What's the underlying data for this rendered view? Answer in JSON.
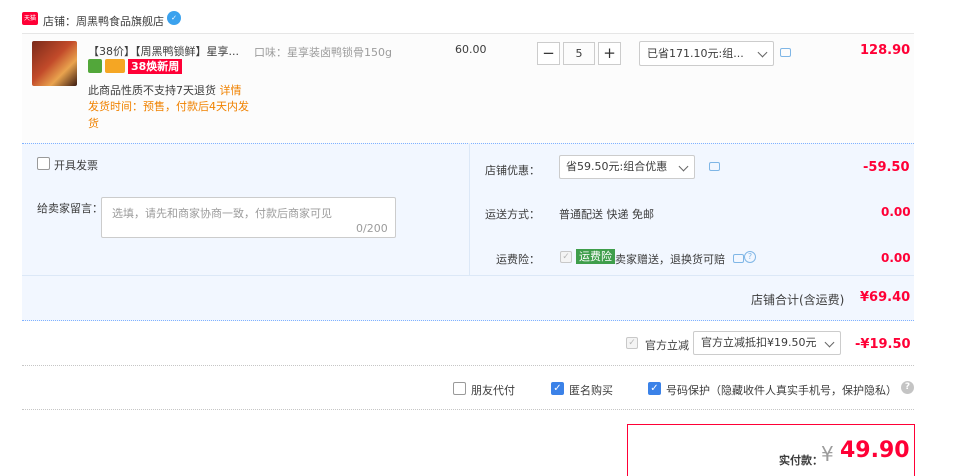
{
  "shop": {
    "icon_name": "tmall-shop-icon",
    "label": "店铺：周黑鸭食品旗舰店",
    "contact_icon_name": "wangwang-chat-icon"
  },
  "item": {
    "title": "【38价】【周黑鸭锁鲜】星享...",
    "promo_badge": "38焕新周",
    "notice": "此商品性质不支持7天退货",
    "notice_link": "详情",
    "ship_time": "发货时间：预售，付款后4天内发货",
    "spec": "口味：星享装卤鸭锁骨150g",
    "unit_price": "60.00",
    "quantity": "5",
    "qty_minus": "−",
    "qty_plus": "+",
    "discount_selected": "已省171.10元:组...",
    "subtotal": "128.90"
  },
  "options": {
    "invoice_label": "开具发票",
    "message_label": "给卖家留言：",
    "message_placeholder": "选填，请先和商家协商一致，付款后商家可见",
    "message_count": "0/200",
    "shop_discount_label": "店铺优惠：",
    "shop_discount_selected": "省59.50元:组合优惠",
    "shop_discount_amount": "-59.50",
    "shipping_label": "运送方式：",
    "shipping_value": "普通配送 快递 免邮",
    "shipping_amount": "0.00",
    "insurance_label": "运费险：",
    "insurance_tag": "运费险",
    "insurance_text": "卖家赠送，退换货可赔",
    "insurance_amount": "0.00",
    "shop_total_label": "店铺合计(含运费)",
    "shop_total_amount": "¥69.40"
  },
  "official": {
    "label": "官方立减",
    "selected": "官方立减抵扣¥19.50元",
    "amount": "-¥19.50"
  },
  "privacy": {
    "friend_pay_label": "朋友代付",
    "friend_pay_checked": false,
    "anonymous_label": "匿名购买",
    "anonymous_checked": true,
    "phone_protect_label": "号码保护（隐藏收件人真实手机号，保护隐私）",
    "phone_protect_checked": true
  },
  "payment": {
    "label": "实付款：",
    "currency": "¥",
    "amount": "49.90"
  },
  "colors": {
    "price_red": "#ff0036",
    "link_orange": "#f08200",
    "option_bg": "#f2f7ff",
    "checkbox_blue": "#3b82e8",
    "insurance_green": "#3f9e4b"
  }
}
